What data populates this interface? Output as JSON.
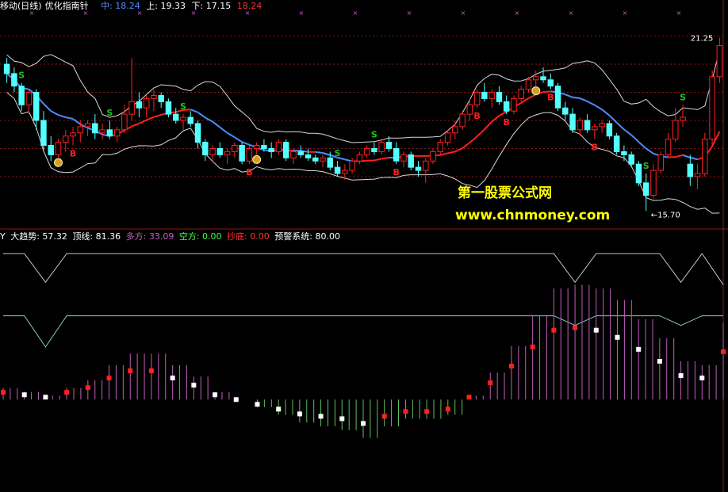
{
  "header": {
    "title_left": "移动(日线)",
    "title_name": "优化指南针",
    "mid_label": "中: 18.24",
    "up_label": "上: 19.33",
    "down_label": "下: 17.15",
    "last_value": "18.24"
  },
  "indicator": {
    "prefix": "Y",
    "trend": "大趋势: 57.32",
    "top": "顶线: 81.36",
    "bull": "多方: 33.09",
    "bear": "空方: 0.00",
    "bottom": "抄底: 0.00",
    "alert": "预警系统: 80.00"
  },
  "watermark": {
    "line1": "第一股票公式网",
    "line2": "www.chnmoney.com"
  },
  "colors": {
    "up": "#ff2020",
    "down": "#54ffff",
    "mid_line_down": "#4c8cff",
    "mid_line_up": "#ff2020",
    "band": "#d8d8d8",
    "grid": "#8c1a1a",
    "signal_s": "#20c020",
    "signal_b": "#ff2020",
    "hist_pos": "#c060c0",
    "hist_neg": "#60c060",
    "top_line": "#c8c8c8",
    "alert_line": "#8cc8c8"
  },
  "chart_data": [
    {
      "type": "candlestick",
      "title": "",
      "price_labels": {
        "high": "21.25",
        "low": "15.70"
      },
      "ylim": [
        15.2,
        22.0
      ],
      "grid_levels": [
        16.8,
        17.7,
        18.6,
        19.5,
        20.4,
        21.3
      ],
      "candles": [
        [
          20.4,
          20.6,
          19.8,
          20.1
        ],
        [
          20.1,
          20.3,
          19.5,
          19.7
        ],
        [
          19.7,
          19.8,
          18.9,
          19.1
        ],
        [
          19.1,
          19.6,
          18.8,
          19.5
        ],
        [
          19.5,
          19.6,
          18.3,
          18.6
        ],
        [
          18.6,
          18.9,
          17.6,
          17.8
        ],
        [
          17.8,
          18.1,
          17.3,
          17.5
        ],
        [
          17.5,
          18.0,
          17.4,
          17.9
        ],
        [
          17.9,
          18.3,
          17.6,
          18.1
        ],
        [
          18.1,
          18.4,
          17.8,
          18.2
        ],
        [
          18.2,
          18.6,
          17.9,
          18.4
        ],
        [
          18.4,
          18.6,
          18.1,
          18.5
        ],
        [
          18.5,
          18.8,
          18.0,
          18.2
        ],
        [
          18.2,
          18.5,
          18.0,
          18.3
        ],
        [
          18.3,
          18.6,
          18.0,
          18.1
        ],
        [
          18.1,
          18.4,
          17.9,
          18.3
        ],
        [
          18.3,
          19.1,
          18.2,
          18.8
        ],
        [
          18.8,
          20.6,
          18.6,
          19.2
        ],
        [
          19.2,
          19.5,
          18.7,
          19.0
        ],
        [
          19.0,
          19.4,
          18.7,
          19.3
        ],
        [
          19.3,
          19.6,
          18.9,
          19.4
        ],
        [
          19.4,
          19.5,
          19.0,
          19.2
        ],
        [
          19.2,
          19.3,
          18.7,
          18.8
        ],
        [
          18.8,
          19.0,
          18.5,
          18.6
        ],
        [
          18.6,
          18.8,
          18.3,
          18.7
        ],
        [
          18.7,
          18.9,
          18.4,
          18.5
        ],
        [
          18.5,
          18.6,
          17.7,
          17.9
        ],
        [
          17.9,
          18.0,
          17.3,
          17.5
        ],
        [
          17.5,
          17.8,
          17.3,
          17.7
        ],
        [
          17.7,
          17.9,
          17.4,
          17.5
        ],
        [
          17.5,
          17.7,
          17.2,
          17.6
        ],
        [
          17.6,
          17.9,
          17.4,
          17.8
        ],
        [
          17.8,
          17.9,
          17.2,
          17.3
        ],
        [
          17.3,
          17.8,
          17.2,
          17.7
        ],
        [
          17.7,
          17.9,
          17.5,
          17.8
        ],
        [
          17.8,
          18.0,
          17.6,
          17.7
        ],
        [
          17.7,
          17.9,
          17.4,
          17.6
        ],
        [
          17.6,
          18.0,
          17.5,
          17.9
        ],
        [
          17.9,
          18.0,
          17.3,
          17.4
        ],
        [
          17.4,
          17.7,
          17.2,
          17.6
        ],
        [
          17.6,
          17.8,
          17.4,
          17.5
        ],
        [
          17.5,
          17.7,
          17.3,
          17.4
        ],
        [
          17.4,
          17.5,
          17.2,
          17.3
        ],
        [
          17.3,
          17.5,
          17.1,
          17.4
        ],
        [
          17.4,
          17.6,
          17.0,
          17.1
        ],
        [
          17.1,
          17.3,
          16.8,
          16.9
        ],
        [
          16.9,
          17.2,
          16.7,
          17.0
        ],
        [
          17.0,
          17.4,
          16.9,
          17.3
        ],
        [
          17.3,
          17.6,
          17.2,
          17.5
        ],
        [
          17.5,
          17.8,
          17.4,
          17.7
        ],
        [
          17.7,
          17.9,
          17.5,
          17.6
        ],
        [
          17.6,
          18.0,
          17.5,
          17.9
        ],
        [
          17.9,
          18.1,
          17.6,
          17.7
        ],
        [
          17.7,
          17.9,
          17.2,
          17.3
        ],
        [
          17.3,
          17.6,
          17.1,
          17.5
        ],
        [
          17.5,
          17.6,
          17.0,
          17.1
        ],
        [
          17.1,
          17.3,
          16.8,
          17.0
        ],
        [
          17.0,
          17.4,
          16.6,
          17.3
        ],
        [
          17.3,
          17.7,
          17.2,
          17.6
        ],
        [
          17.6,
          18.0,
          17.5,
          17.9
        ],
        [
          17.9,
          18.3,
          17.8,
          18.2
        ],
        [
          18.2,
          18.6,
          18.0,
          18.4
        ],
        [
          18.4,
          18.9,
          18.3,
          18.8
        ],
        [
          18.8,
          19.3,
          18.6,
          19.1
        ],
        [
          19.1,
          19.6,
          19.0,
          19.5
        ],
        [
          19.5,
          19.8,
          19.2,
          19.3
        ],
        [
          19.3,
          19.6,
          19.0,
          19.5
        ],
        [
          19.5,
          19.7,
          19.1,
          19.2
        ],
        [
          19.2,
          19.4,
          18.8,
          18.9
        ],
        [
          18.9,
          19.4,
          18.8,
          19.3
        ],
        [
          19.3,
          19.7,
          19.2,
          19.6
        ],
        [
          19.6,
          20.0,
          19.5,
          19.9
        ],
        [
          19.9,
          20.2,
          19.7,
          20.0
        ],
        [
          20.0,
          20.3,
          19.8,
          19.9
        ],
        [
          19.9,
          20.1,
          19.6,
          19.7
        ],
        [
          19.7,
          19.8,
          18.9,
          19.0
        ],
        [
          19.0,
          19.2,
          18.6,
          18.8
        ],
        [
          18.8,
          19.0,
          18.2,
          18.3
        ],
        [
          18.3,
          18.7,
          18.1,
          18.6
        ],
        [
          18.6,
          18.8,
          18.2,
          18.3
        ],
        [
          18.3,
          18.5,
          18.0,
          18.4
        ],
        [
          18.4,
          18.6,
          18.2,
          18.5
        ],
        [
          18.5,
          18.6,
          18.0,
          18.1
        ],
        [
          18.1,
          18.2,
          17.5,
          17.6
        ],
        [
          17.6,
          17.8,
          17.3,
          17.5
        ],
        [
          17.5,
          17.6,
          17.1,
          17.2
        ],
        [
          17.2,
          17.3,
          16.5,
          16.6
        ],
        [
          16.6,
          16.9,
          15.7,
          16.2
        ],
        [
          16.2,
          17.2,
          16.1,
          17.0
        ],
        [
          17.0,
          17.6,
          16.9,
          17.5
        ],
        [
          17.5,
          18.2,
          17.4,
          18.0
        ],
        [
          18.0,
          19.0,
          17.9,
          18.6
        ],
        [
          18.6,
          19.1,
          18.4,
          18.7
        ],
        [
          17.2,
          17.5,
          16.5,
          16.8
        ],
        [
          16.8,
          17.2,
          16.4,
          16.9
        ],
        [
          16.9,
          18.2,
          16.8,
          18.0
        ],
        [
          18.0,
          20.2,
          17.8,
          20.0
        ],
        [
          20.0,
          21.25,
          19.8,
          21.0
        ]
      ],
      "signals": [
        {
          "type": "S",
          "index": 2
        },
        {
          "type": "B",
          "index": 9
        },
        {
          "type": "$",
          "index": 7
        },
        {
          "type": "S",
          "index": 14
        },
        {
          "type": "S",
          "index": 24
        },
        {
          "type": "B",
          "index": 33
        },
        {
          "type": "$",
          "index": 34
        },
        {
          "type": "S",
          "index": 45
        },
        {
          "type": "S",
          "index": 50
        },
        {
          "type": "B",
          "index": 53
        },
        {
          "type": "B",
          "index": 64
        },
        {
          "type": "B",
          "index": 68
        },
        {
          "type": "$",
          "index": 72
        },
        {
          "type": "B",
          "index": 74
        },
        {
          "type": "B",
          "index": 80
        },
        {
          "type": "S",
          "index": 87
        },
        {
          "type": "S",
          "index": 92
        },
        {
          "type": "$",
          "index": 98
        },
        {
          "type": "S",
          "index": 104
        },
        {
          "type": "B",
          "index": 109
        },
        {
          "type": "B",
          "index": 117
        },
        {
          "type": "S",
          "index": 119
        },
        {
          "type": "$",
          "index": 121
        },
        {
          "type": "B",
          "index": 124
        }
      ]
    },
    {
      "type": "line",
      "title": "",
      "ylim": [
        0,
        100
      ],
      "series": [
        {
          "name": "顶线",
          "values": [
            96,
            96,
            84,
            96,
            96,
            96,
            96,
            96,
            96,
            96,
            96,
            96,
            96,
            96,
            96,
            96,
            96,
            96,
            96,
            96,
            96,
            96,
            96,
            96,
            96,
            96,
            96,
            84,
            96,
            96,
            96,
            96,
            84,
            96,
            83
          ]
        },
        {
          "name": "预警系统",
          "values": [
            70,
            70,
            57,
            70,
            70,
            70,
            70,
            70,
            70,
            70,
            70,
            70,
            70,
            70,
            70,
            70,
            70,
            70,
            70,
            70,
            70,
            70,
            70,
            70,
            70,
            70,
            70,
            66,
            70,
            70,
            70,
            70,
            66,
            70,
            70
          ]
        },
        {
          "name": "大趋势",
          "values": [
            38,
            37,
            36,
            38,
            40,
            44,
            47,
            47,
            44,
            41,
            37,
            35,
            33,
            31,
            29,
            28,
            27,
            25,
            28,
            30,
            30,
            31,
            36,
            42,
            49,
            57,
            64,
            65,
            64,
            61,
            56,
            51,
            45,
            44,
            55
          ]
        }
      ]
    }
  ]
}
